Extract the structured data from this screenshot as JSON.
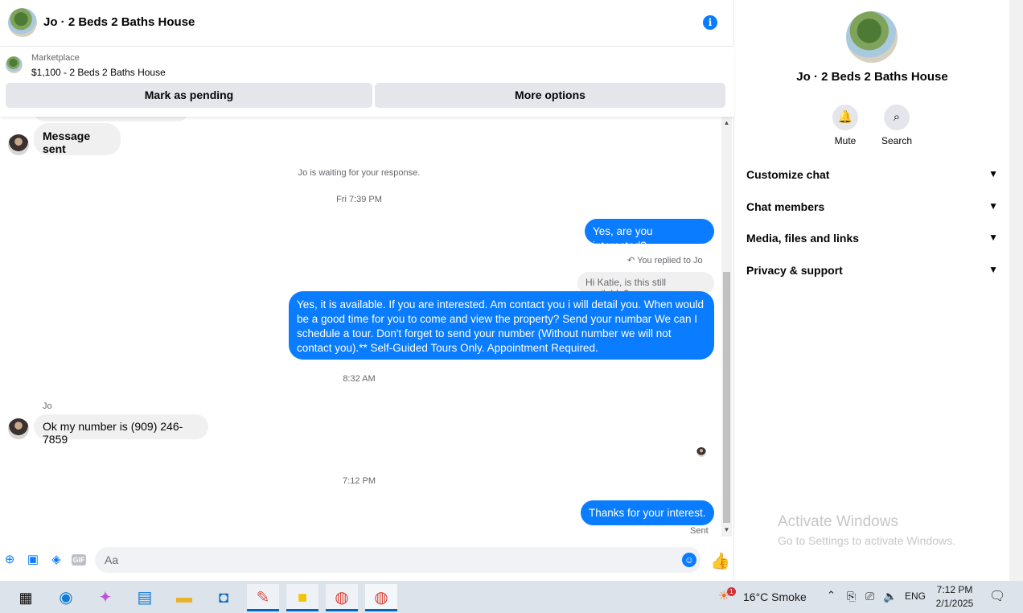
{
  "header": {
    "title": "Jo · 2 Beds 2 Baths House",
    "info_icon": "info-icon"
  },
  "marketplace": {
    "label": "Marketplace",
    "listing": "$1,100 - 2 Beds 2 Baths House",
    "mark_pending": "Mark as pending",
    "more_options": "More options"
  },
  "messages": {
    "msg_sent": "Message sent",
    "waiting": "Jo is waiting for your response.",
    "time1": "Fri 7:39 PM",
    "out1": "Yes, are you interested?",
    "replied_to": "You replied to Jo",
    "quoted": "Hi Katie, is this still available?",
    "out2": "Yes, it is available. If you are interested.  Am contact you i will detail you.  When would be a good time for you to come and view the property? Send your numbar We can I schedule a tour.  Don't forget to send your number (Without number we will not contact you).** Self-Guided Tours Only. Appointment Required.",
    "time2": "8:32 AM",
    "sender": "Jo",
    "in1": "Ok my number is (909) 246-7859",
    "time3": "7:12 PM",
    "out3": "Thanks for your interest.",
    "status": "Sent"
  },
  "composer": {
    "placeholder": "Aa"
  },
  "panel": {
    "title": "Jo · 2 Beds 2 Baths House",
    "mute": "Mute",
    "search": "Search",
    "sections": [
      "Customize chat",
      "Chat members",
      "Media, files and links",
      "Privacy & support"
    ]
  },
  "watermark": {
    "line1": "Activate Windows",
    "line2": "Go to Settings to activate Windows."
  },
  "taskbar": {
    "notification_badge": "1",
    "weather": "16°C  Smoke",
    "lang": "ENG",
    "time": "7:12 PM",
    "date": "2/1/2025"
  },
  "colors": {
    "accent": "#0a7cff",
    "incoming_bubble": "#f0f0f0",
    "taskbar": "#dde3ea"
  }
}
